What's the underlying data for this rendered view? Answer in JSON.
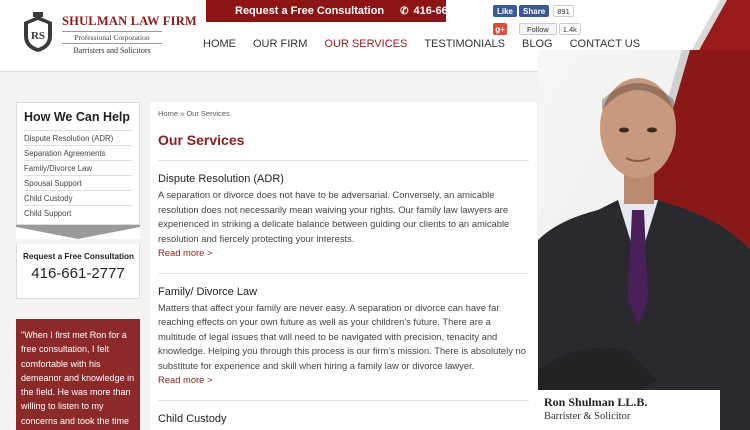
{
  "colors": {
    "brand_red": "#8c1414",
    "nav_active": "#8b1c1c",
    "facebook": "#3b5998",
    "gplus": "#dd4b39"
  },
  "logo": {
    "name": "SHULMAN LAW FIRM",
    "corp": "Professional Corporation",
    "tagline": "Barristers and Solicitors"
  },
  "cta": {
    "label": "Request a Free Consultation",
    "phone_icon": "phone-icon",
    "phone": "416-661-2777"
  },
  "social": {
    "like": "Like",
    "share": "Share",
    "fb_count": "891",
    "gplus": "g+",
    "follow": "Follow",
    "gplus_count": "1.4k"
  },
  "nav": [
    "HOME",
    "OUR FIRM",
    "OUR SERVICES",
    "TESTIMONIALS",
    "BLOG",
    "CONTACT US"
  ],
  "nav_active": "OUR SERVICES",
  "sidebar": {
    "title": "How We Can Help",
    "items": [
      "Dispute Resolution (ADR)",
      "Separation Agreements",
      "Family/Divorce Law",
      "Spousal Support",
      "Child Custody",
      "Child Support"
    ],
    "consult_label": "Request a Free Consultation",
    "consult_phone": "416-661-2777",
    "testimonial": "\"When I first met Ron for a free consultation, I felt comfortable with his demeanor and knowledge in the field. He was more than willing to listen to my concerns and took the time to explain how the law"
  },
  "main": {
    "breadcrumb": "Home » Our Services",
    "title": "Our Services",
    "services": [
      {
        "title": "Dispute Resolution (ADR)",
        "text": "A separation or divorce does not have to be adversarial. Conversely, an amicable resolution does not necessarily mean waiving your rights. Our family law lawyers are experienced in striking a delicate balance between guiding our clients to an amicable resolution and fiercely protecting your interests.",
        "link": "Read more >"
      },
      {
        "title": "Family/ Divorce Law",
        "text": "Matters that affect your family are never easy. A separation or divorce can have far reaching effects on your own future as well as your children's future. There are a multitude of legal issues that will need to be navigated with precision, tenacity and knowledge. Helping you through this process is our firm's mission. There is absolutely no substitute for experience and skill when hiring a family law or divorce lawyer.",
        "link": "Read more >"
      },
      {
        "title": "Child Custody",
        "text": "",
        "link": ""
      }
    ]
  },
  "portrait": {
    "name": "Ron Shulman LL.B.",
    "role": "Barrister & Solicitor"
  }
}
